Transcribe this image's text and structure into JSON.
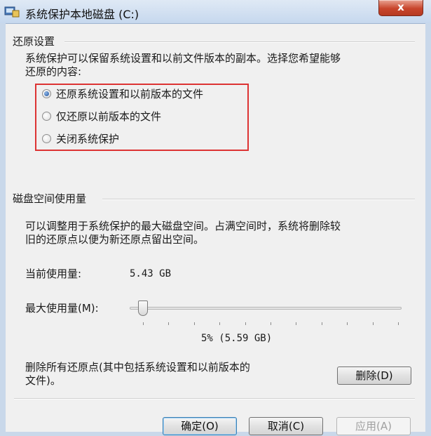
{
  "window": {
    "title": "系统保护本地磁盘 (C:)",
    "close_label": "x"
  },
  "restore_settings": {
    "section_title": "还原设置",
    "description_line1": "系统保护可以保留系统设置和以前文件版本的副本。选择您希望能够",
    "description_line2": "还原的内容:",
    "options": [
      {
        "label": "还原系统设置和以前版本的文件",
        "checked": true
      },
      {
        "label": "仅还原以前版本的文件",
        "checked": false
      },
      {
        "label": "关闭系统保护",
        "checked": false
      }
    ]
  },
  "disk_usage": {
    "section_title": "磁盘空间使用量",
    "description_line1": "可以调整用于系统保护的最大磁盘空间。占满空间时，系统将删除较",
    "description_line2": "旧的还原点以便为新还原点留出空间。",
    "current_label": "当前使用量:",
    "current_value": "5.43 GB",
    "max_label": "最大使用量(M):",
    "slider_value_percent": 5,
    "slider_value_text": "5% (5.59 GB)"
  },
  "delete": {
    "text_line1": "删除所有还原点(其中包括系统设置和以前版本的",
    "text_line2": "文件)。",
    "button_label": "删除(D)"
  },
  "buttons": {
    "ok": "确定(O)",
    "cancel": "取消(C)",
    "apply": "应用(A)"
  }
}
